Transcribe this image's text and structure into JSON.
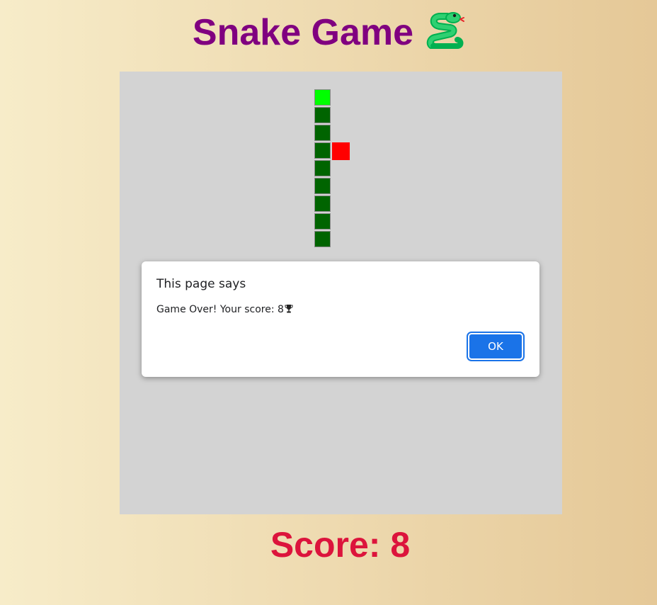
{
  "header": {
    "title": "Snake Game",
    "title_icon": "snake-emoji"
  },
  "game": {
    "board_color": "#d3d3d3",
    "snake_head_color": "#00ff00",
    "snake_body_color": "#006400",
    "food_color": "#ff0000",
    "score_label": "Score: 8",
    "score": 8
  },
  "dialog": {
    "title": "This page says",
    "message": "Game Over! Your score: 8",
    "message_icon": "trophy-icon",
    "ok_label": "OK"
  },
  "colors": {
    "title": "#800080",
    "score": "#dc143c",
    "ok_button": "#1a73e8"
  }
}
